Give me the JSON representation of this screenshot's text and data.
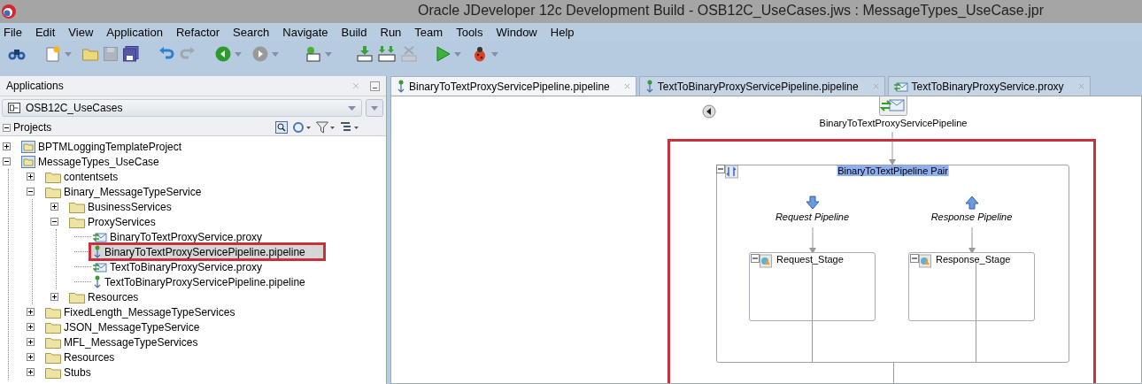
{
  "window": {
    "title": "Oracle JDeveloper 12c Development Build - OSB12C_UseCases.jws : MessageTypes_UseCase.jpr"
  },
  "menu": [
    "File",
    "Edit",
    "View",
    "Application",
    "Refactor",
    "Search",
    "Navigate",
    "Build",
    "Run",
    "Team",
    "Tools",
    "Window",
    "Help"
  ],
  "applications_panel": {
    "title": "Applications",
    "application": "OSB12C_UseCases",
    "section": "Projects",
    "tree": [
      {
        "label": "BPTMLoggingTemplateProject",
        "kind": "project",
        "expanded": false,
        "selected": false
      },
      {
        "label": "MessageTypes_UseCase",
        "kind": "project",
        "expanded": true,
        "selected": false,
        "children": [
          {
            "label": "contentsets",
            "kind": "folder",
            "expanded": false,
            "selected": false
          },
          {
            "label": "Binary_MessageTypeService",
            "kind": "folder",
            "expanded": true,
            "selected": false,
            "children": [
              {
                "label": "BusinessServices",
                "kind": "folder",
                "expanded": false,
                "selected": false
              },
              {
                "label": "ProxyServices",
                "kind": "folder",
                "expanded": true,
                "selected": false,
                "children": [
                  {
                    "label": "BinaryToTextProxyService.proxy",
                    "kind": "proxy",
                    "selected": false
                  },
                  {
                    "label": "BinaryToTextProxyServicePipeline.pipeline",
                    "kind": "pipeline",
                    "selected": true
                  },
                  {
                    "label": "TextToBinaryProxyService.proxy",
                    "kind": "proxy",
                    "selected": false
                  },
                  {
                    "label": "TextToBinaryProxyServicePipeline.pipeline",
                    "kind": "pipeline",
                    "selected": false
                  }
                ]
              },
              {
                "label": "Resources",
                "kind": "folder",
                "expanded": false,
                "selected": false
              }
            ]
          },
          {
            "label": "FixedLength_MessageTypeServices",
            "kind": "folder",
            "expanded": false,
            "selected": false
          },
          {
            "label": "JSON_MessageTypeService",
            "kind": "folder",
            "expanded": false,
            "selected": false
          },
          {
            "label": "MFL_MessageTypeServices",
            "kind": "folder",
            "expanded": false,
            "selected": false
          },
          {
            "label": "Resources",
            "kind": "folder",
            "expanded": false,
            "selected": false
          },
          {
            "label": "Stubs",
            "kind": "folder",
            "expanded": false,
            "selected": false
          }
        ]
      }
    ]
  },
  "editor_tabs": [
    {
      "label": "BinaryToTextProxyServicePipeline.pipeline",
      "kind": "pipeline",
      "selected": true
    },
    {
      "label": "TextToBinaryProxyServicePipeline.pipeline",
      "kind": "pipeline",
      "selected": false
    },
    {
      "label": "TextToBinaryProxyService.proxy",
      "kind": "proxy",
      "selected": false
    }
  ],
  "diagram": {
    "service": "BinaryToTextProxyServicePipeline",
    "pair": "BinaryToTextPipeline Pair",
    "request": {
      "label": "Request Pipeline",
      "stage": "Request_Stage"
    },
    "response": {
      "label": "Response Pipeline",
      "stage": "Response_Stage"
    }
  }
}
